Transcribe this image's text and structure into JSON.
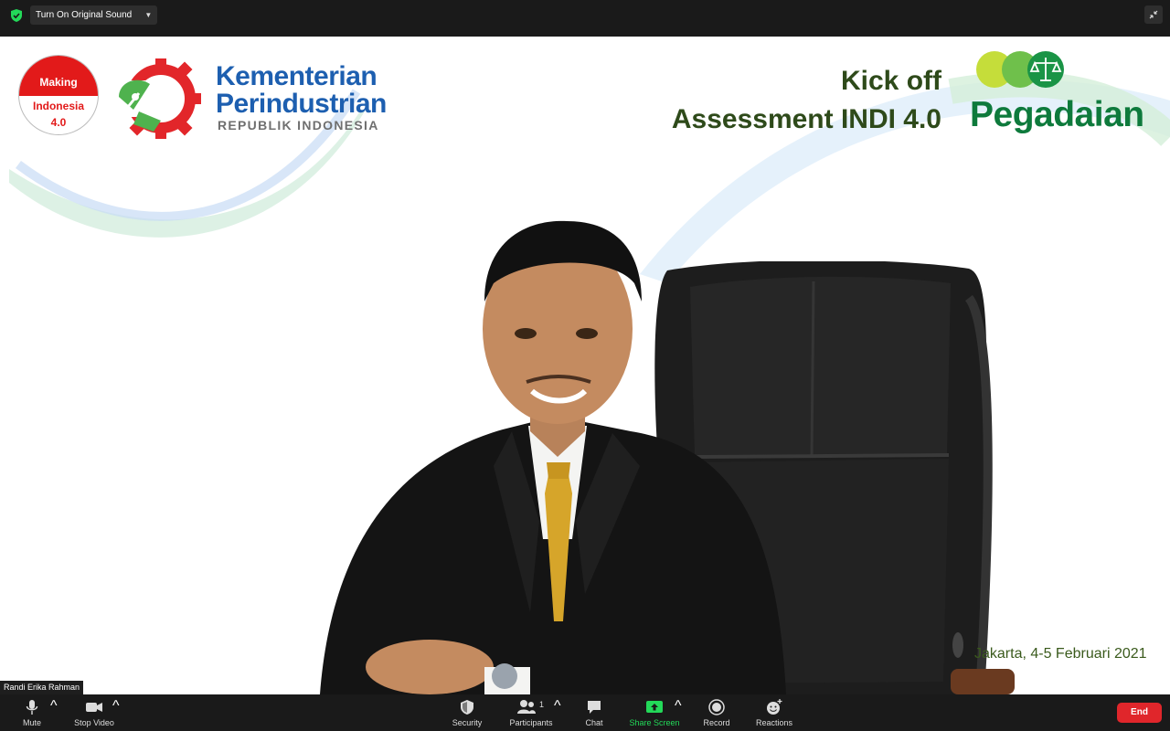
{
  "topbar": {
    "sound_label": "Turn On Original Sound",
    "sound_icon": "shield-check-icon",
    "fullscreen_icon": "exit-fullscreen-icon"
  },
  "slide": {
    "badge": {
      "line1": "Making",
      "line2": "Indonesia",
      "line3": "4.0"
    },
    "kementerian": {
      "line1": "Kementerian",
      "line2": "Perindustrian",
      "line3": "REPUBLIK INDONESIA"
    },
    "kickoff": {
      "line1": "Kick off",
      "line2": "Assessment INDI 4.0"
    },
    "pegadaian": "Pegadaian",
    "caption": "Jakarta, 4-5 Februari 2021",
    "colors": {
      "kemenblue": "#1d5fb0",
      "kickgreen": "#2e4a1a",
      "pegagreen": "#0e7a3c",
      "badgered": "#e21a1a"
    }
  },
  "participant_name": "Randi Erika Rahman",
  "toolbar": {
    "mute": "Mute",
    "stop_video": "Stop Video",
    "security": "Security",
    "participants": "Participants",
    "participants_count": "1",
    "chat": "Chat",
    "share_screen": "Share Screen",
    "record": "Record",
    "reactions": "Reactions",
    "end": "End",
    "share_color": "#23d959"
  }
}
